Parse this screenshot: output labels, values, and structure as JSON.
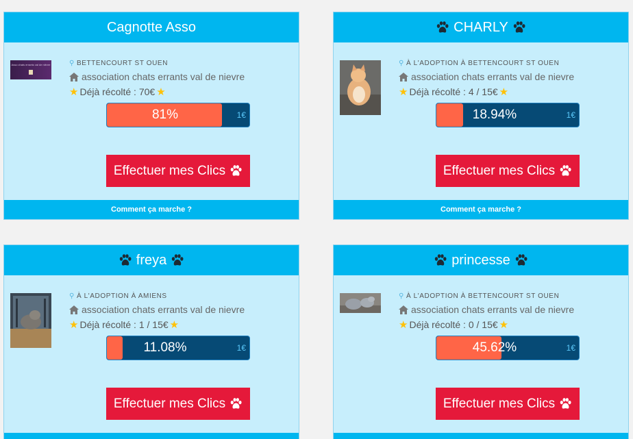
{
  "cards": [
    {
      "title": "Cagnotte Asso",
      "location": "BETTENCOURT ST OUEN",
      "association": "association chats errants val de nievre",
      "collected": "Déjà récolté : 70€",
      "progress_label": "81%",
      "progress_fraction": 0.81,
      "amount": "1€",
      "button": "Effectuer mes Clics",
      "footer": "Comment ça marche ?",
      "thumb_text": "Asso chats errants val de nièvre"
    },
    {
      "title": "CHARLY",
      "location": "À L'ADOPTION À BETTENCOURT ST OUEN",
      "association": "association chats errants val de nievre",
      "collected": "Déjà récolté : 4 / 15€",
      "progress_label": "18.94%",
      "progress_fraction": 0.1894,
      "amount": "1€",
      "button": "Effectuer mes Clics",
      "footer": "Comment ça marche ?"
    },
    {
      "title": "freya",
      "location": "À L'ADOPTION À AMIENS",
      "association": "association chats errants val de nievre",
      "collected": "Déjà récolté : 1 / 15€",
      "progress_label": "11.08%",
      "progress_fraction": 0.1108,
      "amount": "1€",
      "button": "Effectuer mes Clics"
    },
    {
      "title": "princesse",
      "location": "À L'ADOPTION À BETTENCOURT ST OUEN",
      "association": "association chats errants val de nievre",
      "collected": "Déjà récolté : 0 / 15€",
      "progress_label": "45.62%",
      "progress_fraction": 0.4562,
      "amount": "1€",
      "button": "Effectuer mes Clics"
    }
  ],
  "colors": {
    "header": "#00b6ef",
    "card_bg": "#c7eefc",
    "progress_fill": "#ff6547",
    "progress_track": "#064a75",
    "button": "#e5193a",
    "star": "#ffc107"
  },
  "icons": [
    "paw-icon",
    "map-pin-icon",
    "home-icon",
    "star-icon"
  ]
}
